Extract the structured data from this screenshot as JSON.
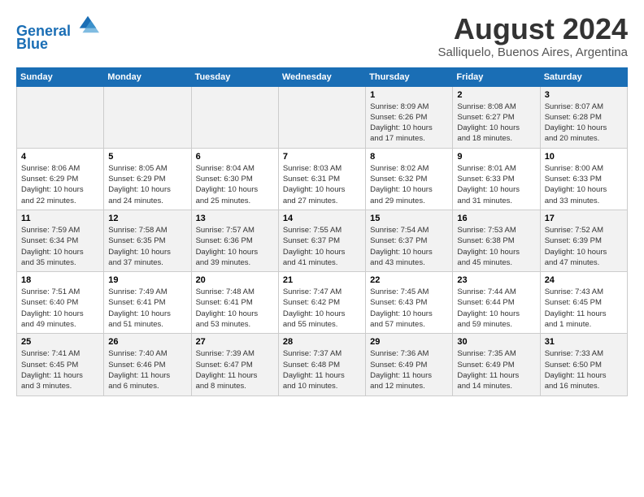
{
  "header": {
    "logo_line1": "General",
    "logo_line2": "Blue",
    "title": "August 2024",
    "subtitle": "Salliquelo, Buenos Aires, Argentina"
  },
  "days_of_week": [
    "Sunday",
    "Monday",
    "Tuesday",
    "Wednesday",
    "Thursday",
    "Friday",
    "Saturday"
  ],
  "weeks": [
    [
      {
        "num": "",
        "info": ""
      },
      {
        "num": "",
        "info": ""
      },
      {
        "num": "",
        "info": ""
      },
      {
        "num": "",
        "info": ""
      },
      {
        "num": "1",
        "info": "Sunrise: 8:09 AM\nSunset: 6:26 PM\nDaylight: 10 hours\nand 17 minutes."
      },
      {
        "num": "2",
        "info": "Sunrise: 8:08 AM\nSunset: 6:27 PM\nDaylight: 10 hours\nand 18 minutes."
      },
      {
        "num": "3",
        "info": "Sunrise: 8:07 AM\nSunset: 6:28 PM\nDaylight: 10 hours\nand 20 minutes."
      }
    ],
    [
      {
        "num": "4",
        "info": "Sunrise: 8:06 AM\nSunset: 6:29 PM\nDaylight: 10 hours\nand 22 minutes."
      },
      {
        "num": "5",
        "info": "Sunrise: 8:05 AM\nSunset: 6:29 PM\nDaylight: 10 hours\nand 24 minutes."
      },
      {
        "num": "6",
        "info": "Sunrise: 8:04 AM\nSunset: 6:30 PM\nDaylight: 10 hours\nand 25 minutes."
      },
      {
        "num": "7",
        "info": "Sunrise: 8:03 AM\nSunset: 6:31 PM\nDaylight: 10 hours\nand 27 minutes."
      },
      {
        "num": "8",
        "info": "Sunrise: 8:02 AM\nSunset: 6:32 PM\nDaylight: 10 hours\nand 29 minutes."
      },
      {
        "num": "9",
        "info": "Sunrise: 8:01 AM\nSunset: 6:33 PM\nDaylight: 10 hours\nand 31 minutes."
      },
      {
        "num": "10",
        "info": "Sunrise: 8:00 AM\nSunset: 6:33 PM\nDaylight: 10 hours\nand 33 minutes."
      }
    ],
    [
      {
        "num": "11",
        "info": "Sunrise: 7:59 AM\nSunset: 6:34 PM\nDaylight: 10 hours\nand 35 minutes."
      },
      {
        "num": "12",
        "info": "Sunrise: 7:58 AM\nSunset: 6:35 PM\nDaylight: 10 hours\nand 37 minutes."
      },
      {
        "num": "13",
        "info": "Sunrise: 7:57 AM\nSunset: 6:36 PM\nDaylight: 10 hours\nand 39 minutes."
      },
      {
        "num": "14",
        "info": "Sunrise: 7:55 AM\nSunset: 6:37 PM\nDaylight: 10 hours\nand 41 minutes."
      },
      {
        "num": "15",
        "info": "Sunrise: 7:54 AM\nSunset: 6:37 PM\nDaylight: 10 hours\nand 43 minutes."
      },
      {
        "num": "16",
        "info": "Sunrise: 7:53 AM\nSunset: 6:38 PM\nDaylight: 10 hours\nand 45 minutes."
      },
      {
        "num": "17",
        "info": "Sunrise: 7:52 AM\nSunset: 6:39 PM\nDaylight: 10 hours\nand 47 minutes."
      }
    ],
    [
      {
        "num": "18",
        "info": "Sunrise: 7:51 AM\nSunset: 6:40 PM\nDaylight: 10 hours\nand 49 minutes."
      },
      {
        "num": "19",
        "info": "Sunrise: 7:49 AM\nSunset: 6:41 PM\nDaylight: 10 hours\nand 51 minutes."
      },
      {
        "num": "20",
        "info": "Sunrise: 7:48 AM\nSunset: 6:41 PM\nDaylight: 10 hours\nand 53 minutes."
      },
      {
        "num": "21",
        "info": "Sunrise: 7:47 AM\nSunset: 6:42 PM\nDaylight: 10 hours\nand 55 minutes."
      },
      {
        "num": "22",
        "info": "Sunrise: 7:45 AM\nSunset: 6:43 PM\nDaylight: 10 hours\nand 57 minutes."
      },
      {
        "num": "23",
        "info": "Sunrise: 7:44 AM\nSunset: 6:44 PM\nDaylight: 10 hours\nand 59 minutes."
      },
      {
        "num": "24",
        "info": "Sunrise: 7:43 AM\nSunset: 6:45 PM\nDaylight: 11 hours\nand 1 minute."
      }
    ],
    [
      {
        "num": "25",
        "info": "Sunrise: 7:41 AM\nSunset: 6:45 PM\nDaylight: 11 hours\nand 3 minutes."
      },
      {
        "num": "26",
        "info": "Sunrise: 7:40 AM\nSunset: 6:46 PM\nDaylight: 11 hours\nand 6 minutes."
      },
      {
        "num": "27",
        "info": "Sunrise: 7:39 AM\nSunset: 6:47 PM\nDaylight: 11 hours\nand 8 minutes."
      },
      {
        "num": "28",
        "info": "Sunrise: 7:37 AM\nSunset: 6:48 PM\nDaylight: 11 hours\nand 10 minutes."
      },
      {
        "num": "29",
        "info": "Sunrise: 7:36 AM\nSunset: 6:49 PM\nDaylight: 11 hours\nand 12 minutes."
      },
      {
        "num": "30",
        "info": "Sunrise: 7:35 AM\nSunset: 6:49 PM\nDaylight: 11 hours\nand 14 minutes."
      },
      {
        "num": "31",
        "info": "Sunrise: 7:33 AM\nSunset: 6:50 PM\nDaylight: 11 hours\nand 16 minutes."
      }
    ]
  ]
}
